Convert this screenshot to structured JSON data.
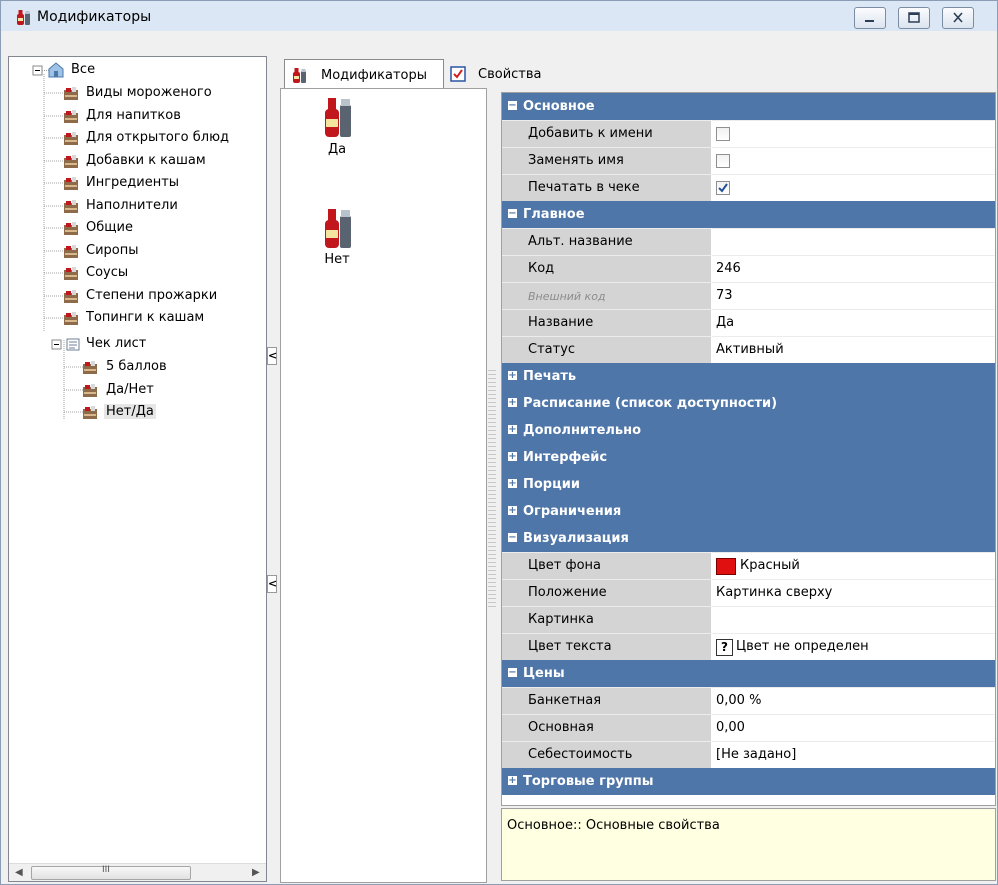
{
  "window": {
    "title": "Модификаторы",
    "icon": "ketchup-bottle-icon"
  },
  "controls": {
    "minimize": "minimize-icon",
    "maximize": "maximize-icon",
    "close": "close-icon"
  },
  "tree": {
    "root": "Все",
    "items": [
      "Виды мороженого",
      "Для напитков",
      "Для открытого блюд",
      "Добавки к кашам",
      "Ингредиенты",
      "Наполнители",
      "Общие",
      "Сиропы",
      "Соусы",
      "Степени прожарки",
      "Топинги к кашам"
    ],
    "checklist": {
      "label": "Чек лист",
      "children": [
        "5 баллов",
        "Да/Нет",
        "Нет/Да"
      ],
      "selected": "Нет/Да"
    },
    "scroll_mark": "III"
  },
  "tabs": [
    {
      "label": "Модификаторы",
      "icon": "ketchup-bottle-icon",
      "active": true
    },
    {
      "label": "Свойства",
      "icon": "properties-check-icon",
      "active": false
    }
  ],
  "modifiers": [
    {
      "label": "Да"
    },
    {
      "label": "Нет"
    }
  ],
  "grid": {
    "cat_osnovnoe": "Основное",
    "p_add_name": "Добавить к имени",
    "v_add_name": false,
    "p_replace_name": "Заменять имя",
    "v_replace_name": false,
    "p_print_check": "Печатать в чеке",
    "v_print_check": true,
    "cat_glavnoe": "Главное",
    "p_alt_name": "Альт. название",
    "v_alt_name": "",
    "p_code": "Код",
    "v_code": "246",
    "p_ext_code": "Внешний код",
    "v_ext_code": "73",
    "p_name": "Название",
    "v_name": "Да",
    "p_status": "Статус",
    "v_status": "Активный",
    "cat_print": "Печать",
    "cat_schedule": "Расписание (список доступности)",
    "cat_extra": "Дополнительно",
    "cat_interface": "Интерфейс",
    "cat_portions": "Порции",
    "cat_limits": "Ограничения",
    "cat_visual": "Визуализация",
    "p_bg_color": "Цвет фона",
    "v_bg_color": "Красный",
    "bg_color_hex": "#e01010",
    "p_position": "Положение",
    "v_position": "Картинка сверху",
    "p_picture": "Картинка",
    "v_picture": "",
    "p_text_color": "Цвет текста",
    "v_text_color": "Цвет не определен",
    "cat_prices": "Цены",
    "p_banquet": "Банкетная",
    "v_banquet": "0,00 %",
    "p_base": "Основная",
    "v_base": "0,00",
    "p_cost": "Себестоимость",
    "v_cost": "[Не задано]",
    "cat_trade": "Торговые группы"
  },
  "description": "Основное:: Основные свойства",
  "colors": {
    "category_bg": "#4f76a8",
    "key_bg": "#d4d4d4",
    "desc_bg": "#ffffe1"
  }
}
